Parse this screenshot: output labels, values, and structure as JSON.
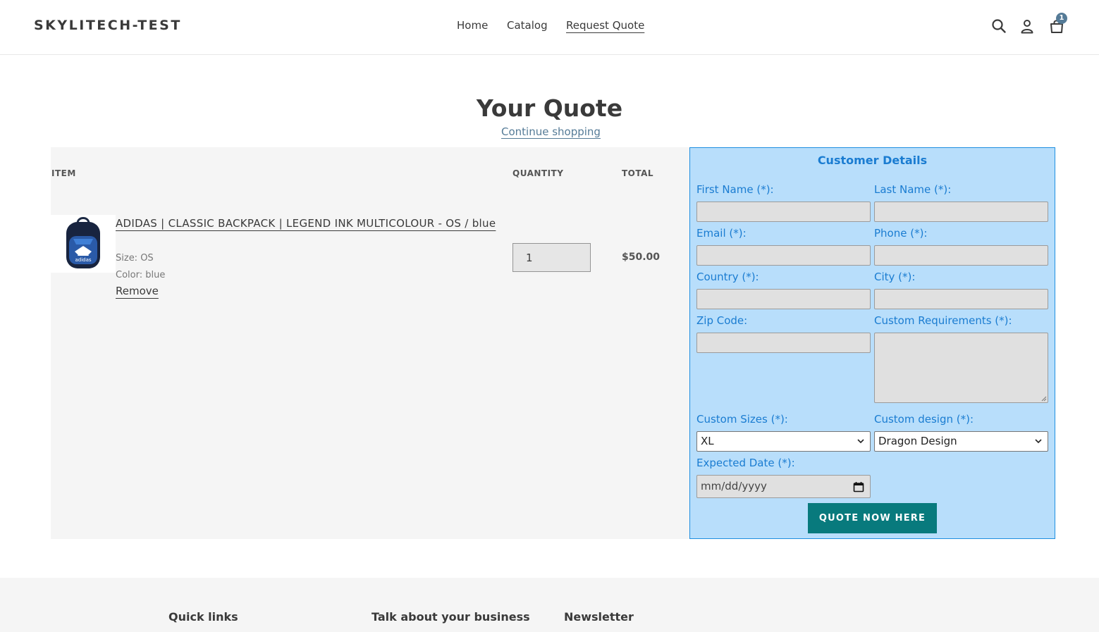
{
  "header": {
    "logo": "SKYLITECH-TEST",
    "nav": {
      "home": "Home",
      "catalog": "Catalog",
      "request_quote": "Request Quote"
    },
    "cart_count": "1"
  },
  "page": {
    "title": "Your Quote",
    "continue": "Continue shopping"
  },
  "table": {
    "col_item": "ITEM",
    "col_quantity": "QUANTITY",
    "col_total": "TOTAL"
  },
  "item": {
    "title": "ADIDAS | CLASSIC BACKPACK | LEGEND INK MULTICOLOUR - OS / blue",
    "size": "Size: OS",
    "color": "Color: blue",
    "remove": "Remove",
    "quantity": "1",
    "total": "$50.00",
    "image_text": "adidas"
  },
  "form": {
    "title": "Customer Details",
    "first_name": "First Name (*):",
    "last_name": "Last Name (*):",
    "email": "Email (*):",
    "phone": "Phone (*):",
    "country": "Country (*):",
    "city": "City (*):",
    "zip": "Zip Code:",
    "requirements": "Custom Requirements (*):",
    "sizes": "Custom Sizes (*):",
    "sizes_value": "XL",
    "design": "Custom design (*):",
    "design_value": "Dragon Design",
    "date": "Expected Date (*):",
    "date_placeholder": "mm/dd/yyyy",
    "submit": "QUOTE NOW HERE"
  },
  "footer": {
    "quick_links": "Quick links",
    "business": "Talk about your business",
    "newsletter": "Newsletter"
  },
  "colors": {
    "accent": "#557b97",
    "form_bg": "#b8defb",
    "form_text": "#1a7cd1",
    "button": "#087a7d"
  }
}
